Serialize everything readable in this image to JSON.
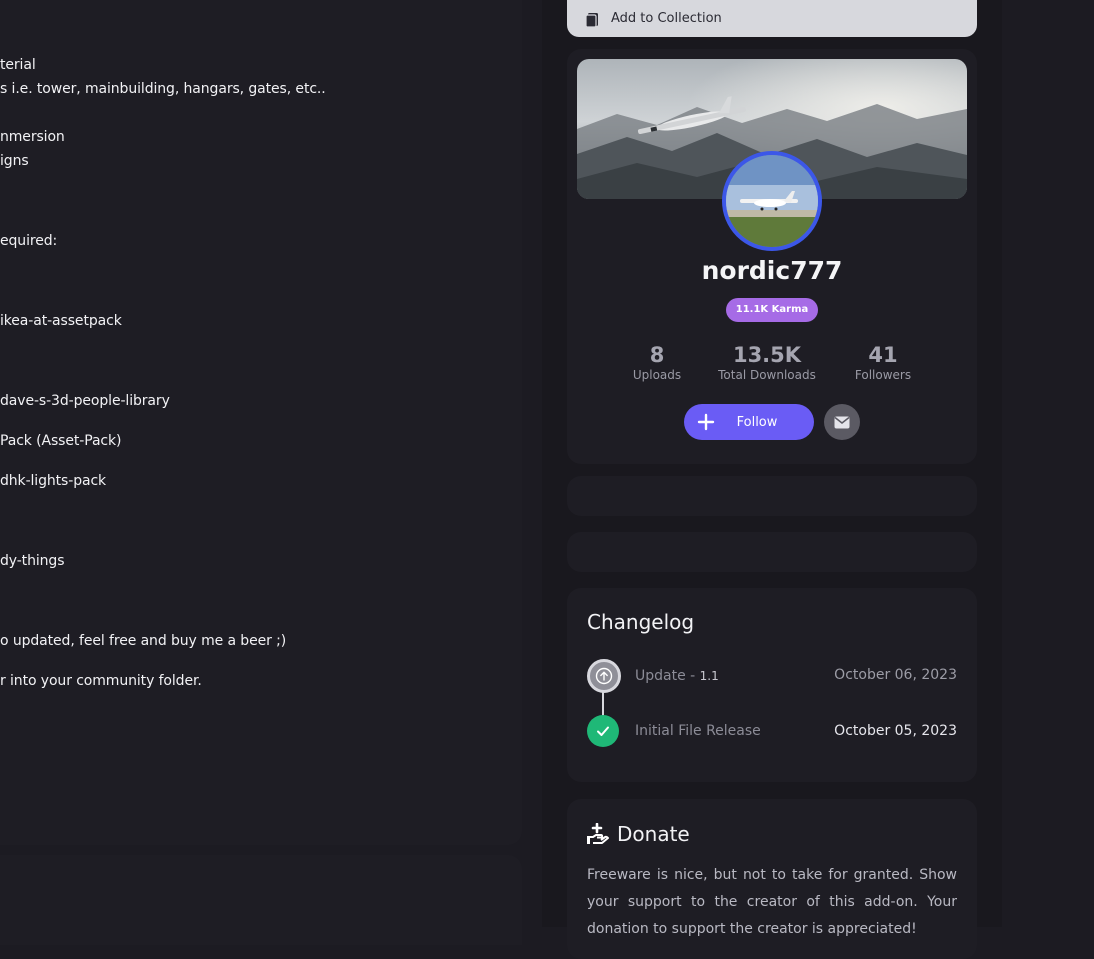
{
  "description_lines": [
    "terial",
    "s i.e. tower, mainbuilding, hangars, gates, etc..",
    "nmersion",
    "igns",
    "equired:",
    "ikea-at-assetpack",
    "dave-s-3d-people-library",
    "Pack (Asset-Pack)",
    "dhk-lights-pack",
    "dy-things",
    "o updated, feel free and buy me a beer ;)",
    "r into your community folder."
  ],
  "collection": {
    "label": "Add to Collection",
    "icon": "clipboard-icon"
  },
  "profile": {
    "username": "nordic777",
    "karma": "11.1K Karma",
    "stats": [
      {
        "value": "8",
        "label": "Uploads"
      },
      {
        "value": "13.5K",
        "label": "Total Downloads"
      },
      {
        "value": "41",
        "label": "Followers"
      }
    ],
    "follow_label": "Follow",
    "message_icon": "envelope-icon"
  },
  "changelog": {
    "title": "Changelog",
    "entries": [
      {
        "label": "Update - ",
        "version": "1.1",
        "date": "October 06, 2023",
        "icon": "arrow-up-icon"
      },
      {
        "label": "Initial File Release",
        "version": "",
        "date": "October 05, 2023",
        "icon": "check-icon"
      }
    ]
  },
  "donate": {
    "title": "Donate",
    "icon": "hand-donate-icon",
    "text": "Freeware is nice, but not to take for granted. Show your support to the creator of this add-on. Your donation to support the creator is appreciated!"
  },
  "colors": {
    "accent": "#6a5cf5",
    "karma": "#a66be6",
    "avatar_ring": "#3c57e8",
    "success": "#1fb877"
  }
}
